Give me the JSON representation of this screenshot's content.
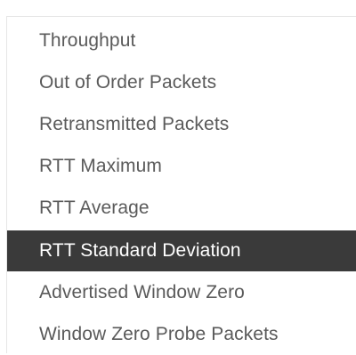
{
  "menu": {
    "selected_index": 5,
    "items": [
      {
        "label": "Throughput"
      },
      {
        "label": "Out of Order Packets"
      },
      {
        "label": "Retransmitted Packets"
      },
      {
        "label": "RTT Maximum"
      },
      {
        "label": "RTT Average"
      },
      {
        "label": "RTT Standard Deviation"
      },
      {
        "label": "Advertised Window Zero"
      },
      {
        "label": "Window Zero Probe Packets"
      }
    ]
  },
  "colors": {
    "text": "#5a5a5a",
    "selected_background": "#3a3a3a",
    "selected_text": "#ffffff",
    "border": "#e6e6e6"
  }
}
